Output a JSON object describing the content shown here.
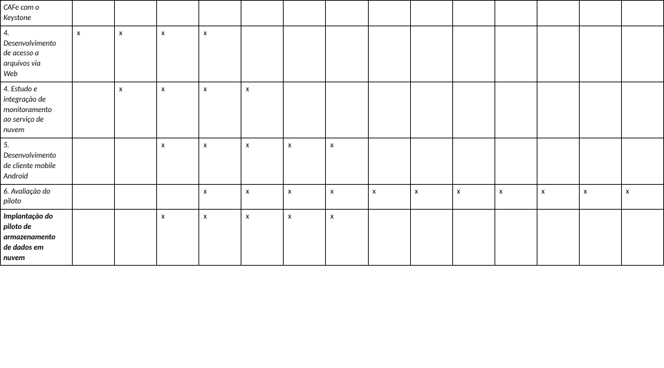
{
  "mark": "x",
  "rows": [
    {
      "label_lines": [
        "CAFe com o",
        "Keystone"
      ],
      "style": "italic",
      "marks": [
        false,
        false,
        false,
        false,
        false,
        false,
        false,
        false,
        false,
        false,
        false,
        false,
        false,
        false
      ]
    },
    {
      "label_lines": [
        "4.",
        "Desenvolvimento",
        "de acesso a",
        "arquivos via",
        "Web"
      ],
      "style": "italic",
      "marks": [
        true,
        true,
        true,
        true,
        false,
        false,
        false,
        false,
        false,
        false,
        false,
        false,
        false,
        false
      ]
    },
    {
      "label_lines": [
        "4. Estudo e",
        "integração de",
        "monitoramento",
        "ao serviço de",
        "nuvem"
      ],
      "style": "italic",
      "marks": [
        false,
        true,
        true,
        true,
        true,
        false,
        false,
        false,
        false,
        false,
        false,
        false,
        false,
        false
      ]
    },
    {
      "label_lines": [
        "5.",
        "Desenvolvimento",
        "de cliente mobile",
        "Android"
      ],
      "style": "italic",
      "marks": [
        false,
        false,
        true,
        true,
        true,
        true,
        true,
        false,
        false,
        false,
        false,
        false,
        false,
        false
      ]
    },
    {
      "label_lines": [
        "6. Avaliação do",
        "piloto"
      ],
      "style": "italic",
      "marks": [
        false,
        false,
        false,
        true,
        true,
        true,
        true,
        true,
        true,
        true,
        true,
        true,
        true,
        true
      ]
    },
    {
      "label_lines": [
        "Implantação do",
        "piloto de",
        "armazenamento",
        "de dados em",
        "nuvem"
      ],
      "style": "bold-italic",
      "marks": [
        false,
        false,
        true,
        true,
        true,
        true,
        true,
        false,
        false,
        false,
        false,
        false,
        false,
        false
      ]
    }
  ]
}
